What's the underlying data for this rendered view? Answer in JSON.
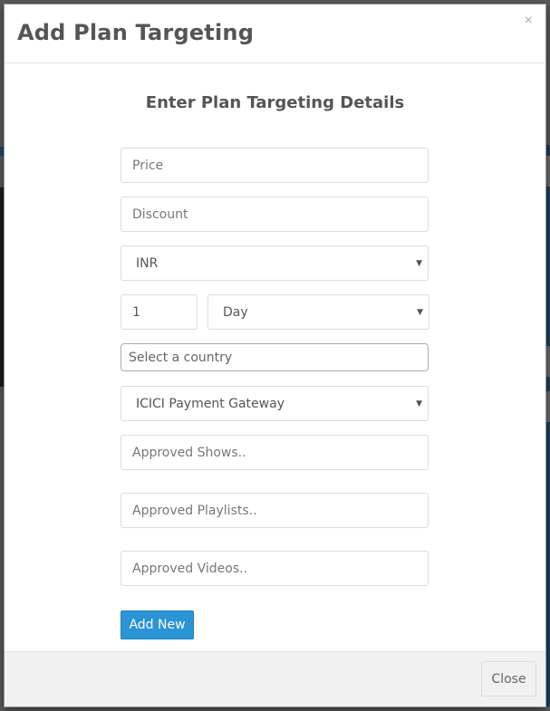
{
  "modal": {
    "title": "Add Plan Targeting",
    "close_icon": "×",
    "heading": "Enter Plan Targeting Details"
  },
  "form": {
    "price": {
      "placeholder": "Price",
      "value": ""
    },
    "discount": {
      "placeholder": "Discount",
      "value": ""
    },
    "currency": {
      "selected": "INR"
    },
    "duration_count": {
      "value": "1"
    },
    "duration_unit": {
      "selected": "Day"
    },
    "country": {
      "placeholder": "Select a country"
    },
    "payment_gateway": {
      "selected": "ICICI Payment Gateway"
    },
    "approved_shows": {
      "placeholder": "Approved Shows.."
    },
    "approved_playlists": {
      "placeholder": "Approved Playlists.."
    },
    "approved_videos": {
      "placeholder": "Approved Videos.."
    },
    "caret_icon": "▼",
    "add_button": "Add New"
  },
  "footer": {
    "close_button": "Close"
  },
  "colors": {
    "primary": "#2a94d6",
    "backdrop": "#5a5a5a"
  }
}
